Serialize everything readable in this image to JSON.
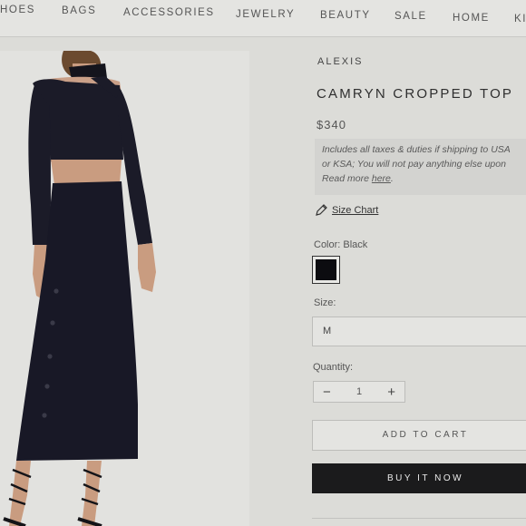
{
  "nav": {
    "items": [
      "HOES",
      "BAGS",
      "ACCESSORIES",
      "JEWELRY",
      "BEAUTY",
      "SALE",
      "HOME",
      "KI"
    ]
  },
  "product": {
    "brand": "ALEXIS",
    "title": "CAMRYN CROPPED TOP",
    "price": "$340",
    "notice": {
      "line1": "Includes all taxes & duties if shipping to USA",
      "line2": "or KSA; You will not pay anything else upon",
      "read_more": "Read more",
      "link": "here",
      "end": "."
    },
    "size_chart": "Size Chart",
    "color_label": "Color: Black",
    "swatch_color": "#0c0c10",
    "size_label": "Size:",
    "size_value": "M",
    "quantity_label": "Quantity:",
    "quantity_value": "1",
    "minus": "−",
    "plus": "+",
    "add_to_cart": "ADD TO CART",
    "buy_now": "BUY IT NOW"
  },
  "icons": {
    "size_chart": "pencil-ruler-icon"
  }
}
